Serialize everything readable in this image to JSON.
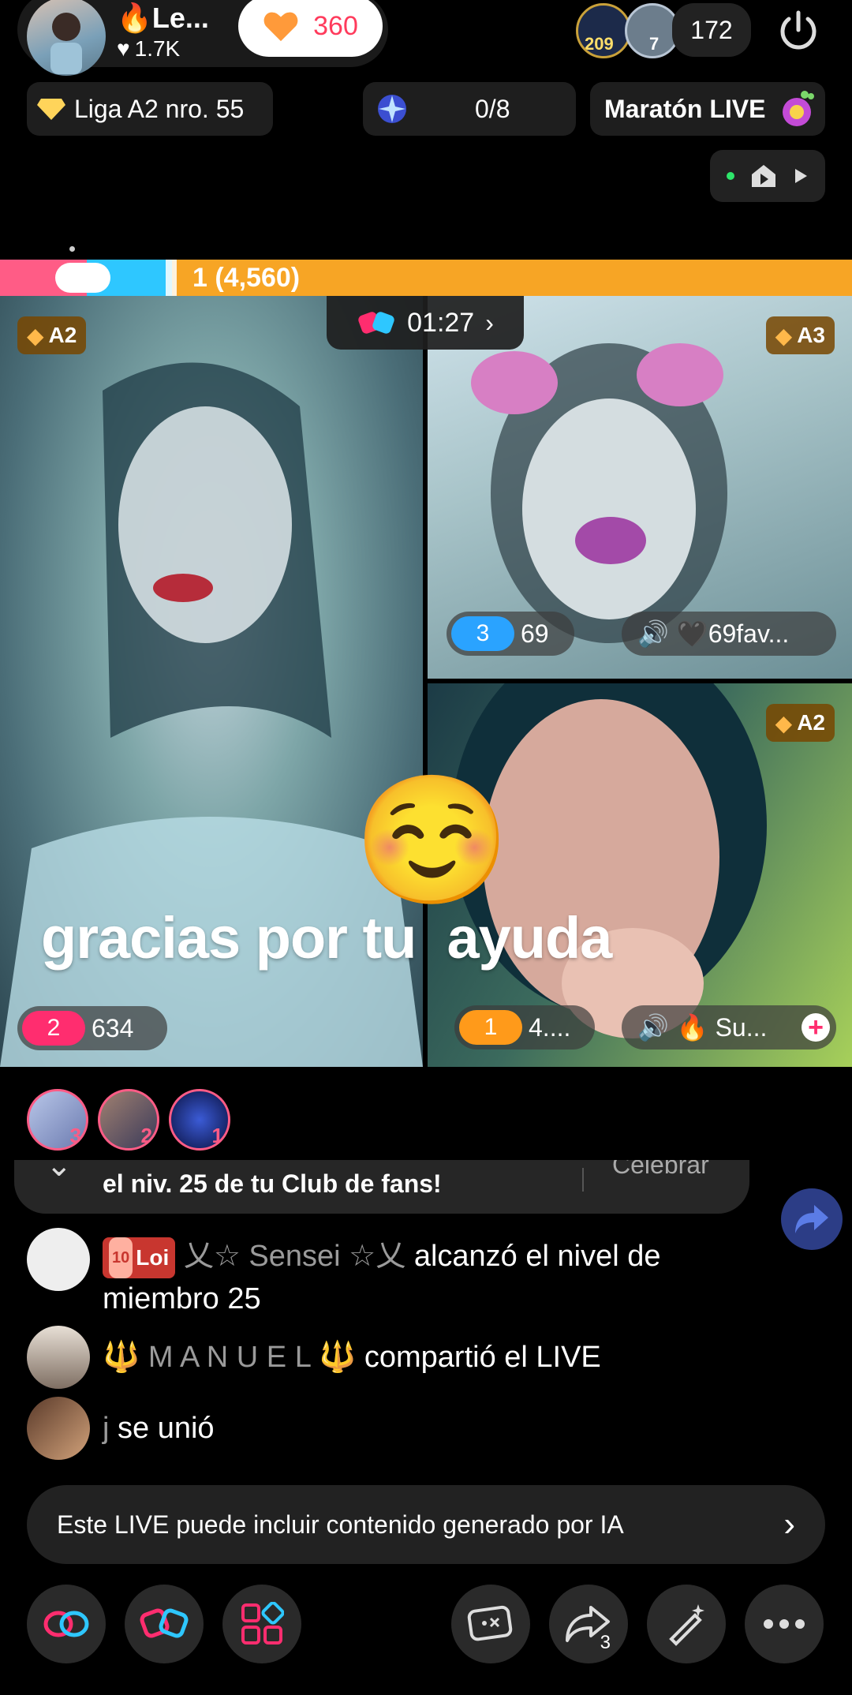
{
  "host": {
    "name": "🔥Le...",
    "likes": "1.7K",
    "heart_count": "360"
  },
  "top_right": {
    "badge1": "209",
    "badge2": "7",
    "viewers": "172"
  },
  "chips": {
    "league": "Liga A2 nro. 55",
    "goal": "0/8",
    "marathon": "Maratón LIVE"
  },
  "ranking_bar": {
    "label": "1 (4,560)"
  },
  "battle": {
    "timer": "01:27"
  },
  "tiles": [
    {
      "badge": "A2",
      "rank": "2",
      "score": "634",
      "rank_color": "#ff2d6f"
    },
    {
      "badge": "A3",
      "rank": "3",
      "score": "69",
      "rank_color": "#2aa3ff",
      "name": "🖤69fav..."
    },
    {
      "badge": "A2",
      "rank": "1",
      "score": "4....",
      "rank_color": "#ff9a1a",
      "name": "🔥 Su..."
    }
  ],
  "overlay": {
    "emoji": "☺️",
    "caption": "gracias por tu  ayuda"
  },
  "supporters": [
    "3",
    "2",
    "1"
  ],
  "banner": {
    "text": "el niv. 25 de tu Club de fans!",
    "action": "Celebrar"
  },
  "chat": [
    {
      "badge": "Loi",
      "badge_num": "10",
      "user": "乂☆ Sensei ☆乂",
      "msg": " alcanzó el nivel de miembro 25"
    },
    {
      "user": "🔱 M A N U E L 🔱",
      "msg": " compartió el LIVE"
    },
    {
      "user": "j",
      "msg": " se unió"
    }
  ],
  "ai_notice": {
    "text": "Este LIVE puede incluir contenido generado por IA"
  },
  "bottom_bar": {
    "share_count": "3"
  },
  "colors": {
    "accent_pink": "#ff2d6f",
    "accent_orange": "#ff9a1a",
    "accent_blue": "#2aa3ff",
    "bar_orange": "#f7a525"
  }
}
